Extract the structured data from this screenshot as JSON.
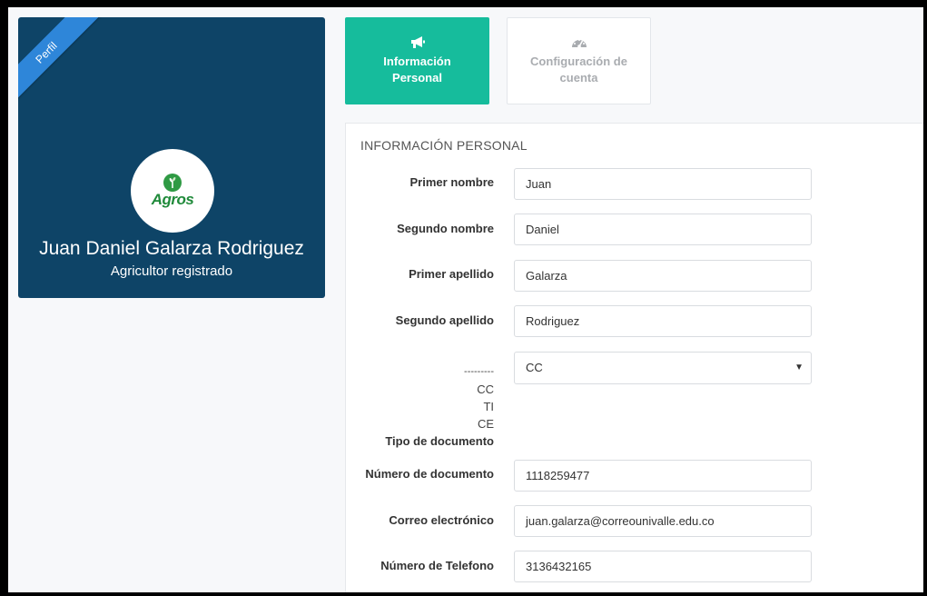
{
  "profile": {
    "ribbon": "Perfil",
    "logo_text": "Agros",
    "name": "Juan Daniel Galarza Rodriguez",
    "role": "Agricultor registrado",
    "card_color": "#0e4467",
    "ribbon_color": "#2e86d9"
  },
  "tabs": [
    {
      "icon": "megaphone-icon",
      "line1": "Información",
      "line2": "Personal",
      "active": true
    },
    {
      "icon": "dashboard-icon",
      "line1": "Configuración de",
      "line2": "cuenta",
      "active": false
    }
  ],
  "accent_color": "#16bc9c",
  "section": {
    "title": "INFORMACIÓN PERSONAL",
    "fields": [
      {
        "label": "Primer nombre",
        "value": "Juan"
      },
      {
        "label": "Segundo nombre",
        "value": "Daniel"
      },
      {
        "label": "Primer apellido",
        "value": "Galarza"
      },
      {
        "label": "Segundo apellido",
        "value": "Rodriguez"
      }
    ],
    "document_type": {
      "label": "Tipo de documento",
      "options": [
        "---------",
        "CC",
        "TI",
        "CE"
      ],
      "selected": "CC"
    },
    "fields2": [
      {
        "label": "Número de documento",
        "value": "1118259477"
      },
      {
        "label": "Correo electrónico",
        "value": "juan.galarza@correounivalle.edu.co"
      },
      {
        "label": "Número de Telefono",
        "value": "3136432165"
      }
    ]
  }
}
